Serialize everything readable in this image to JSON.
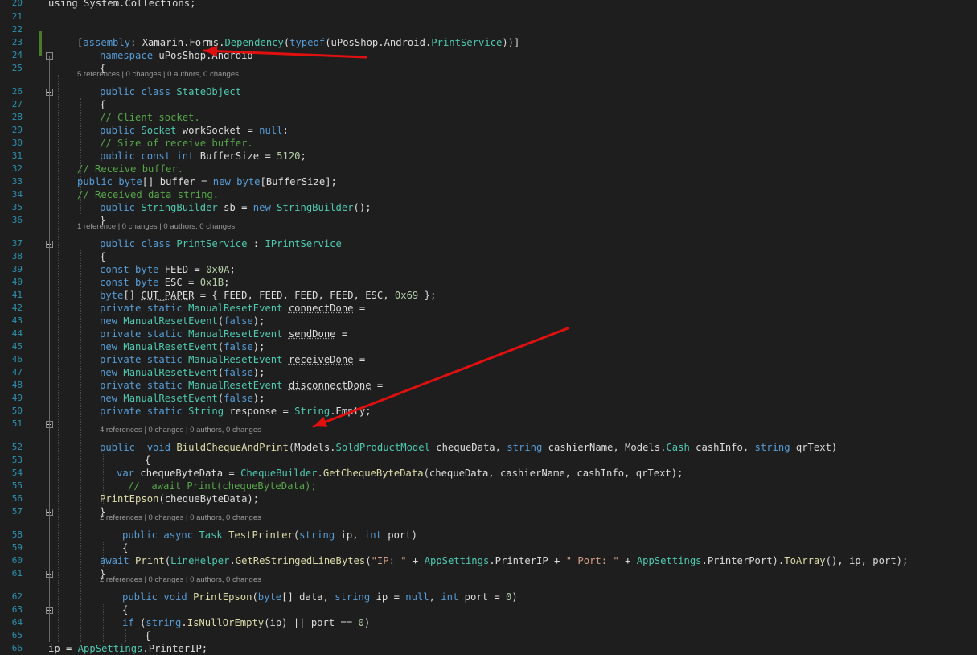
{
  "code": [
    {
      "num": "20",
      "tokens": [
        {
          "t": "using System.Collections;",
          "c": "tx"
        }
      ]
    },
    {
      "num": "21",
      "tokens": []
    },
    {
      "num": "22",
      "tokens": []
    },
    {
      "num": "23",
      "tokens": [
        {
          "t": "[",
          "c": "tx"
        },
        {
          "t": "assembly",
          "c": "kw"
        },
        {
          "t": ": Xamarin.Forms.",
          "c": "tx"
        },
        {
          "t": "Dependency",
          "c": "ty"
        },
        {
          "t": "(",
          "c": "tx"
        },
        {
          "t": "typeof",
          "c": "kw"
        },
        {
          "t": "(uPosShop.Android.",
          "c": "tx"
        },
        {
          "t": "PrintService",
          "c": "ty"
        },
        {
          "t": "))]",
          "c": "tx"
        }
      ]
    },
    {
      "num": "24",
      "tokens": [
        {
          "t": "namespace",
          "c": "kw"
        },
        {
          "t": " uPosShop.Android",
          "c": "tx"
        }
      ]
    },
    {
      "num": "25",
      "tokens": [
        {
          "t": "{",
          "c": "tx"
        }
      ]
    },
    {
      "num": "26",
      "tokens": [
        {
          "t": "public class ",
          "c": "kw"
        },
        {
          "t": "StateObject",
          "c": "ty"
        }
      ]
    },
    {
      "num": "27",
      "tokens": [
        {
          "t": "{",
          "c": "tx"
        }
      ]
    },
    {
      "num": "28",
      "tokens": [
        {
          "t": "// Client socket.",
          "c": "cm"
        }
      ]
    },
    {
      "num": "29",
      "tokens": [
        {
          "t": "public ",
          "c": "kw"
        },
        {
          "t": "Socket",
          "c": "ty"
        },
        {
          "t": " workSocket = ",
          "c": "tx"
        },
        {
          "t": "null",
          "c": "kw"
        },
        {
          "t": ";",
          "c": "tx"
        }
      ]
    },
    {
      "num": "30",
      "tokens": [
        {
          "t": "// Size of receive buffer.",
          "c": "cm"
        }
      ]
    },
    {
      "num": "31",
      "tokens": [
        {
          "t": "public const int",
          "c": "kw"
        },
        {
          "t": " BufferSize = ",
          "c": "tx"
        },
        {
          "t": "5120",
          "c": "nm"
        },
        {
          "t": ";",
          "c": "tx"
        }
      ]
    },
    {
      "num": "32",
      "tokens": [
        {
          "t": "// Receive buffer.",
          "c": "cm"
        }
      ]
    },
    {
      "num": "33",
      "tokens": [
        {
          "t": "public byte",
          "c": "kw"
        },
        {
          "t": "[] buffer = ",
          "c": "tx"
        },
        {
          "t": "new byte",
          "c": "kw"
        },
        {
          "t": "[BufferSize];",
          "c": "tx"
        }
      ]
    },
    {
      "num": "34",
      "tokens": [
        {
          "t": "// Received data string.",
          "c": "cm"
        }
      ]
    },
    {
      "num": "35",
      "tokens": [
        {
          "t": "public ",
          "c": "kw"
        },
        {
          "t": "StringBuilder",
          "c": "ty"
        },
        {
          "t": " sb = ",
          "c": "tx"
        },
        {
          "t": "new ",
          "c": "kw"
        },
        {
          "t": "StringBuilder",
          "c": "ty"
        },
        {
          "t": "();",
          "c": "tx"
        }
      ]
    },
    {
      "num": "36",
      "tokens": [
        {
          "t": "}",
          "c": "tx"
        }
      ]
    },
    {
      "num": "37",
      "tokens": [
        {
          "t": "public class ",
          "c": "kw"
        },
        {
          "t": "PrintService",
          "c": "ty"
        },
        {
          "t": " : ",
          "c": "tx"
        },
        {
          "t": "IPrintService",
          "c": "ty"
        }
      ]
    },
    {
      "num": "38",
      "tokens": [
        {
          "t": "{",
          "c": "tx"
        }
      ]
    },
    {
      "num": "39",
      "tokens": [
        {
          "t": "const byte",
          "c": "kw"
        },
        {
          "t": " FEED = ",
          "c": "tx"
        },
        {
          "t": "0x0A",
          "c": "nm"
        },
        {
          "t": ";",
          "c": "tx"
        }
      ]
    },
    {
      "num": "40",
      "tokens": [
        {
          "t": "const byte",
          "c": "kw"
        },
        {
          "t": " ESC = ",
          "c": "tx"
        },
        {
          "t": "0x1B",
          "c": "nm"
        },
        {
          "t": ";",
          "c": "tx"
        }
      ]
    },
    {
      "num": "41",
      "tokens": [
        {
          "t": "byte",
          "c": "kw"
        },
        {
          "t": "[] ",
          "c": "tx"
        },
        {
          "t": "CUT_PAPER",
          "c": "tx sq"
        },
        {
          "t": " = { FEED, FEED, FEED, FEED, ESC, ",
          "c": "tx"
        },
        {
          "t": "0x69",
          "c": "nm"
        },
        {
          "t": " };",
          "c": "tx"
        }
      ]
    },
    {
      "num": "42",
      "tokens": [
        {
          "t": "private static ",
          "c": "kw"
        },
        {
          "t": "ManualResetEvent",
          "c": "ty"
        },
        {
          "t": " ",
          "c": "tx"
        },
        {
          "t": "connectDone",
          "c": "tx sq"
        },
        {
          "t": " =",
          "c": "tx"
        }
      ]
    },
    {
      "num": "43",
      "tokens": [
        {
          "t": "new ",
          "c": "kw"
        },
        {
          "t": "ManualResetEvent",
          "c": "ty"
        },
        {
          "t": "(",
          "c": "tx"
        },
        {
          "t": "false",
          "c": "kw"
        },
        {
          "t": ");",
          "c": "tx"
        }
      ]
    },
    {
      "num": "44",
      "tokens": [
        {
          "t": "private static ",
          "c": "kw"
        },
        {
          "t": "ManualResetEvent",
          "c": "ty"
        },
        {
          "t": " ",
          "c": "tx"
        },
        {
          "t": "sendDone",
          "c": "tx sq"
        },
        {
          "t": " =",
          "c": "tx"
        }
      ]
    },
    {
      "num": "45",
      "tokens": [
        {
          "t": "new ",
          "c": "kw"
        },
        {
          "t": "ManualResetEvent",
          "c": "ty"
        },
        {
          "t": "(",
          "c": "tx"
        },
        {
          "t": "false",
          "c": "kw"
        },
        {
          "t": ");",
          "c": "tx"
        }
      ]
    },
    {
      "num": "46",
      "tokens": [
        {
          "t": "private static ",
          "c": "kw"
        },
        {
          "t": "ManualResetEvent",
          "c": "ty"
        },
        {
          "t": " ",
          "c": "tx"
        },
        {
          "t": "receiveDone",
          "c": "tx sq"
        },
        {
          "t": " =",
          "c": "tx"
        }
      ]
    },
    {
      "num": "47",
      "tokens": [
        {
          "t": "new ",
          "c": "kw"
        },
        {
          "t": "ManualResetEvent",
          "c": "ty"
        },
        {
          "t": "(",
          "c": "tx"
        },
        {
          "t": "false",
          "c": "kw"
        },
        {
          "t": ");",
          "c": "tx"
        }
      ]
    },
    {
      "num": "48",
      "tokens": [
        {
          "t": "private static ",
          "c": "kw"
        },
        {
          "t": "ManualResetEvent",
          "c": "ty"
        },
        {
          "t": " ",
          "c": "tx"
        },
        {
          "t": "disconnectDone",
          "c": "tx sq"
        },
        {
          "t": " =",
          "c": "tx"
        }
      ]
    },
    {
      "num": "49",
      "tokens": [
        {
          "t": "new ",
          "c": "kw"
        },
        {
          "t": "ManualResetEvent",
          "c": "ty"
        },
        {
          "t": "(",
          "c": "tx"
        },
        {
          "t": "false",
          "c": "kw"
        },
        {
          "t": ");",
          "c": "tx"
        }
      ]
    },
    {
      "num": "50",
      "tokens": [
        {
          "t": "private static ",
          "c": "kw"
        },
        {
          "t": "String",
          "c": "ty"
        },
        {
          "t": " response = ",
          "c": "tx"
        },
        {
          "t": "String",
          "c": "ty"
        },
        {
          "t": ".Empty;",
          "c": "tx"
        }
      ]
    },
    {
      "num": "51",
      "tokens": []
    },
    {
      "num": "52",
      "tokens": [
        {
          "t": "public  void ",
          "c": "kw"
        },
        {
          "t": "BiuldChequeAndPrint",
          "c": "fn"
        },
        {
          "t": "(Models.",
          "c": "tx"
        },
        {
          "t": "SoldProductModel",
          "c": "ty"
        },
        {
          "t": " chequeData, ",
          "c": "tx"
        },
        {
          "t": "string",
          "c": "kw"
        },
        {
          "t": " cashierName, Models.",
          "c": "tx"
        },
        {
          "t": "Cash",
          "c": "ty"
        },
        {
          "t": " cashInfo, ",
          "c": "tx"
        },
        {
          "t": "string",
          "c": "kw"
        },
        {
          "t": " qrText)",
          "c": "tx"
        }
      ]
    },
    {
      "num": "53",
      "tokens": [
        {
          "t": "{",
          "c": "tx"
        }
      ]
    },
    {
      "num": "54",
      "tokens": [
        {
          "t": "var",
          "c": "kw"
        },
        {
          "t": " chequeByteData = ",
          "c": "tx"
        },
        {
          "t": "ChequeBuilder",
          "c": "ty"
        },
        {
          "t": ".",
          "c": "tx"
        },
        {
          "t": "GetChequeByteData",
          "c": "fn"
        },
        {
          "t": "(chequeData, cashierName, cashInfo, qrText);",
          "c": "tx"
        }
      ]
    },
    {
      "num": "55",
      "tokens": [
        {
          "t": "//  await Print(chequeByteData);",
          "c": "cm"
        }
      ]
    },
    {
      "num": "56",
      "tokens": [
        {
          "t": "PrintEpson",
          "c": "fn"
        },
        {
          "t": "(chequeByteData);",
          "c": "tx"
        }
      ]
    },
    {
      "num": "57",
      "tokens": [
        {
          "t": "}",
          "c": "tx"
        }
      ]
    },
    {
      "num": "58",
      "tokens": [
        {
          "t": "public async ",
          "c": "kw"
        },
        {
          "t": "Task",
          "c": "ty"
        },
        {
          "t": " ",
          "c": "tx"
        },
        {
          "t": "TestPrinter",
          "c": "fn"
        },
        {
          "t": "(",
          "c": "tx"
        },
        {
          "t": "string",
          "c": "kw"
        },
        {
          "t": " ip, ",
          "c": "tx"
        },
        {
          "t": "int",
          "c": "kw"
        },
        {
          "t": " port)",
          "c": "tx"
        }
      ]
    },
    {
      "num": "59",
      "tokens": [
        {
          "t": "{",
          "c": "tx"
        }
      ]
    },
    {
      "num": "60",
      "tokens": [
        {
          "t": "await ",
          "c": "kw"
        },
        {
          "t": "Print",
          "c": "fn"
        },
        {
          "t": "(",
          "c": "tx"
        },
        {
          "t": "LineHelper",
          "c": "ty"
        },
        {
          "t": ".",
          "c": "tx"
        },
        {
          "t": "GetReStringedLineBytes",
          "c": "fn"
        },
        {
          "t": "(",
          "c": "tx"
        },
        {
          "t": "\"IP: \"",
          "c": "st"
        },
        {
          "t": " + ",
          "c": "tx"
        },
        {
          "t": "AppSettings",
          "c": "ty"
        },
        {
          "t": ".PrinterIP + ",
          "c": "tx"
        },
        {
          "t": "\" Port: \"",
          "c": "st"
        },
        {
          "t": " + ",
          "c": "tx"
        },
        {
          "t": "AppSettings",
          "c": "ty"
        },
        {
          "t": ".PrinterPort).",
          "c": "tx"
        },
        {
          "t": "ToArray",
          "c": "fn"
        },
        {
          "t": "(), ip, port);",
          "c": "tx"
        }
      ]
    },
    {
      "num": "61",
      "tokens": [
        {
          "t": "}",
          "c": "tx"
        }
      ]
    },
    {
      "num": "62",
      "tokens": [
        {
          "t": "public void ",
          "c": "kw"
        },
        {
          "t": "PrintEpson",
          "c": "fn"
        },
        {
          "t": "(",
          "c": "tx"
        },
        {
          "t": "byte",
          "c": "kw"
        },
        {
          "t": "[] data, ",
          "c": "tx"
        },
        {
          "t": "string",
          "c": "kw"
        },
        {
          "t": " ip = ",
          "c": "tx"
        },
        {
          "t": "null",
          "c": "kw"
        },
        {
          "t": ", ",
          "c": "tx"
        },
        {
          "t": "int",
          "c": "kw"
        },
        {
          "t": " port = ",
          "c": "tx"
        },
        {
          "t": "0",
          "c": "nm"
        },
        {
          "t": ")",
          "c": "tx"
        }
      ]
    },
    {
      "num": "63",
      "tokens": [
        {
          "t": "{",
          "c": "tx"
        }
      ]
    },
    {
      "num": "64",
      "tokens": [
        {
          "t": "if",
          "c": "kw"
        },
        {
          "t": " (",
          "c": "tx"
        },
        {
          "t": "string",
          "c": "kw"
        },
        {
          "t": ".",
          "c": "tx"
        },
        {
          "t": "IsNullOrEmpty",
          "c": "fn"
        },
        {
          "t": "(ip) || port == ",
          "c": "tx"
        },
        {
          "t": "0",
          "c": "nm"
        },
        {
          "t": ")",
          "c": "tx"
        }
      ]
    },
    {
      "num": "65",
      "tokens": [
        {
          "t": "{",
          "c": "tx"
        }
      ]
    },
    {
      "num": "66",
      "tokens": [
        {
          "t": "ip = ",
          "c": "tx"
        },
        {
          "t": "AppSettings",
          "c": "ty"
        },
        {
          "t": ".PrinterIP;",
          "c": "tx"
        }
      ]
    }
  ],
  "codelens": [
    {
      "text": "5 references | 0 changes | 0 authors, 0 changes"
    },
    {
      "text": "1 reference | 0 changes | 0 authors, 0 changes"
    },
    {
      "text": "4 references | 0 changes | 0 authors, 0 changes"
    },
    {
      "text": "2 references | 0 changes | 0 authors, 0 changes"
    },
    {
      "text": "2 references | 0 changes | 0 authors, 0 changes"
    }
  ],
  "colors": {
    "background": "#1e1e1e",
    "line_number": "#2b91af",
    "keyword": "#569cd6",
    "type": "#4ec9b0",
    "comment": "#57a64a",
    "string": "#d69d85",
    "number": "#b5cea8",
    "method": "#dcdcaa",
    "text": "#dcdcdc",
    "codelens": "#999999",
    "annotation_arrow": "#e01010",
    "change_marker": "#4b7a2f"
  },
  "annotations": [
    {
      "kind": "arrow",
      "icon": "red-arrow-icon",
      "points_to": "namespace uPosShop.Android"
    },
    {
      "kind": "arrow",
      "icon": "red-arrow-icon",
      "points_to": "4 references | 0 changes | 0 authors, 0 changes"
    }
  ]
}
